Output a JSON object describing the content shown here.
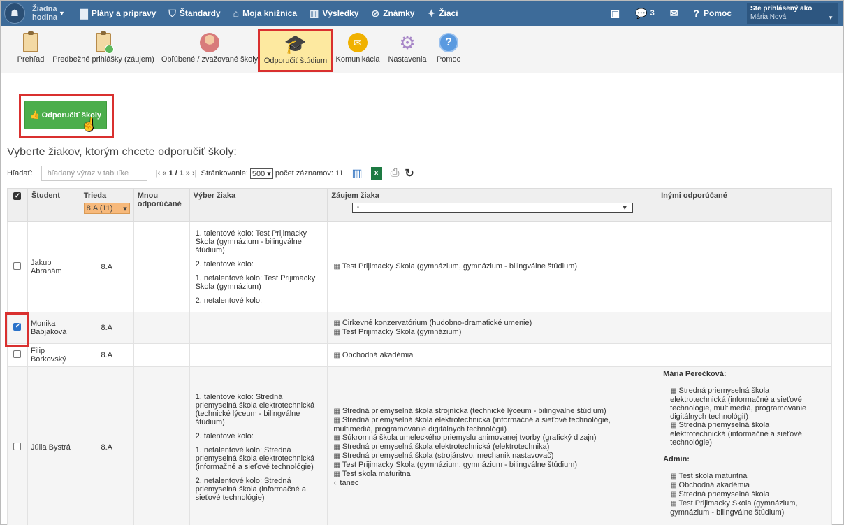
{
  "topnav": {
    "hour_label": "Žiadna hodina",
    "items": [
      {
        "label": "Plány a prípravy",
        "icon": "briefcase-icon",
        "glyph": "▇"
      },
      {
        "label": "Štandardy",
        "icon": "shield-icon",
        "glyph": "⛉"
      },
      {
        "label": "Moja knižnica",
        "icon": "library-icon",
        "glyph": "⌂"
      },
      {
        "label": "Výsledky",
        "icon": "bar-chart-icon",
        "glyph": "▥"
      },
      {
        "label": "Známky",
        "icon": "grade-icon",
        "glyph": "⊘"
      },
      {
        "label": "Žiaci",
        "icon": "students-icon",
        "glyph": "✦"
      }
    ],
    "messages_count": "3",
    "help_label": "Pomoc",
    "user_caption": "Ste prihlásený ako",
    "user_name": "Mária Nová"
  },
  "toolbar": {
    "items": [
      {
        "label": "Prehľad"
      },
      {
        "label": "Predbežné prihlášky (záujem)"
      },
      {
        "label": "Obľúbené / zvažované školy"
      },
      {
        "label": "Odporučiť štúdium"
      },
      {
        "label": "Komunikácia"
      },
      {
        "label": "Nastavenia"
      },
      {
        "label": "Pomoc"
      }
    ]
  },
  "recommend_button": "Odporučiť školy",
  "heading": "Vyberte žiakov, ktorým chcete odporučiť školy:",
  "search": {
    "label": "Hľadať:",
    "placeholder": "hľadaný výraz v tabuľke",
    "pager_prefix": "|‹ « ",
    "pager_page": "1 / 1",
    "pager_suffix": " » ›|",
    "page_size_label": "Stránkovanie:",
    "page_size": "500",
    "records_label": "počet záznamov: 11"
  },
  "table": {
    "headers": {
      "student": "Študent",
      "class": "Trieda",
      "class_filter": "8.A (11)",
      "mnou": "Mnou odporúčané",
      "choice": "Výber žiaka",
      "interest": "Záujem žiaka",
      "interest_filter": "*",
      "others": "Inými odporúčané"
    },
    "rows": [
      {
        "name": "Jakub Abrahám",
        "checked": false,
        "class": "8.A",
        "choice": [
          "1. talentové kolo: Test Prijimacky Skola (gymnázium - bilingválne štúdium)",
          "2. talentové kolo:",
          "1. netalentové kolo: Test Prijimacky Skola (gymnázium)",
          "2. netalentové kolo:"
        ],
        "interest": [
          "Test Prijimacky Skola (gymnázium, gymnázium - bilingválne štúdium)"
        ]
      },
      {
        "name": "Monika Babjaková",
        "checked": true,
        "class": "8.A",
        "choice": [],
        "interest": [
          "Cirkevné konzervatórium (hudobno-dramatické umenie)",
          "Test Prijimacky Skola (gymnázium)"
        ]
      },
      {
        "name": "Filip Borkovský",
        "checked": false,
        "class": "8.A",
        "choice": [],
        "interest": [
          "Obchodná akadémia"
        ]
      },
      {
        "name": "Júlia Bystrá",
        "checked": false,
        "class": "8.A",
        "choice": [
          "1. talentové kolo: Stredná priemyselná škola elektrotechnická (technické lýceum - bilingválne štúdium)",
          "2. talentové kolo:",
          "1. netalentové kolo: Stredná priemyselná škola elektrotechnická (informačné a sieťové technológie)",
          "2. netalentové kolo: Stredná priemyselná škola (informačné a sieťové technológie)"
        ],
        "interest": [
          "Stredná priemyselná škola strojnícka (technické lýceum - bilingválne štúdium)",
          "Stredná priemyselná škola elektrotechnická (informačné a sieťové technológie, multimédiá, programovanie digitálnych technológií)",
          "Súkromná škola umeleckého priemyslu animovanej tvorby (grafický dizajn)",
          "Stredná priemyselná škola elektrotechnická (elektrotechnika)",
          "Stredná priemyselná škola (strojárstvo, mechanik nastavovač)",
          "Test Prijimacky Skola (gymnázium, gymnázium - bilingválne štúdium)",
          "Test skola maturitna"
        ],
        "interest_extra": "tanec",
        "others": [
          {
            "name": "Mária Perečková:",
            "schools": [
              "Stredná priemyselná škola elektrotechnická (informačné a sieťové technológie, multimédiá, programovanie digitálnych technológií)",
              "Stredná priemyselná škola elektrotechnická (informačné a sieťové technológie)"
            ]
          },
          {
            "name": "Admin:",
            "schools": [
              "Test skola maturitna",
              "Obchodná akadémia",
              "Stredná priemyselná škola",
              "Test Prijimacky Skola (gymnázium, gymnázium - bilingválne štúdium)"
            ]
          }
        ]
      }
    ]
  }
}
